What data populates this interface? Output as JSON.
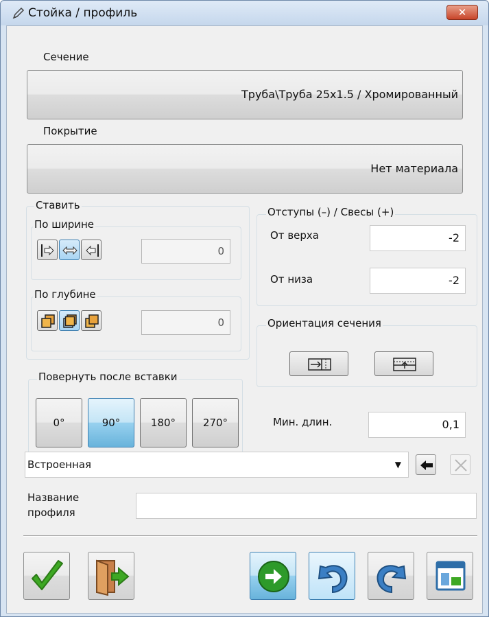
{
  "window": {
    "title": "Стойка / профиль",
    "close_label": "✕"
  },
  "section": {
    "label": "Сечение",
    "value": "Труба\\Труба 25x1.5 / Хромированный"
  },
  "coating": {
    "label": "Покрытие",
    "value": "Нет материала"
  },
  "place": {
    "title": "Ставить",
    "width": {
      "title": "По ширине",
      "value": "0"
    },
    "depth": {
      "title": "По глубине",
      "value": "0"
    }
  },
  "offsets": {
    "title": "Отступы (–) / Свесы (+)",
    "top_label": "От верха",
    "top_value": "-2",
    "bottom_label": "От низа",
    "bottom_value": "-2"
  },
  "orientation": {
    "title": "Ориентация сечения"
  },
  "rotate": {
    "title": "Повернуть после вставки",
    "options": [
      "0°",
      "90°",
      "180°",
      "270°"
    ],
    "selected": "90°"
  },
  "min_length": {
    "label": "Мин. длин.",
    "value": "0,1"
  },
  "profile_type": {
    "value": "Встроенная",
    "arrow": "▼"
  },
  "profile_name": {
    "label_line1": "Название",
    "label_line2": "профиля",
    "value": ""
  },
  "icons": {
    "title": "pencil-icon",
    "ok": "checkmark-icon",
    "exit": "exit-door-icon",
    "next": "arrow-right-icon",
    "undo": "undo-icon",
    "redo": "redo-icon",
    "layout": "layout-icon"
  },
  "colors": {
    "accent_blue": "#68b3db",
    "ok_green": "#4caf2a",
    "close_red": "#c8452a"
  }
}
